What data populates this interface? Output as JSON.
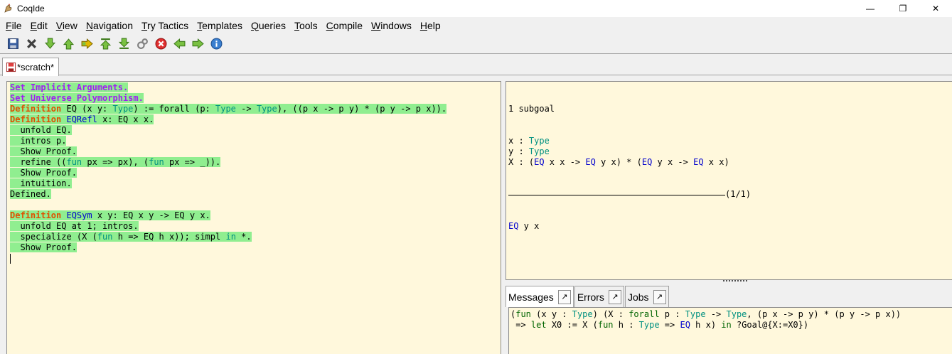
{
  "window": {
    "title": "CoqIde",
    "controls": {
      "minimize": "—",
      "restore": "❐",
      "close": "✕"
    }
  },
  "menu": [
    "File",
    "Edit",
    "View",
    "Navigation",
    "Try Tactics",
    "Templates",
    "Queries",
    "Tools",
    "Compile",
    "Windows",
    "Help"
  ],
  "toolbar_icons": [
    "save-icon",
    "close-icon",
    "step-forward-icon",
    "step-backward-icon",
    "goto-cursor-icon",
    "goto-start-icon",
    "goto-end-icon",
    "interrupt-icon",
    "stop-icon",
    "previous-occurrence-icon",
    "next-occurrence-icon",
    "info-icon"
  ],
  "tab": {
    "label": "*scratch*"
  },
  "script": {
    "lines": [
      [
        {
          "t": "Set Implicit Arguments.",
          "c": "kw"
        }
      ],
      [
        {
          "t": "Set Universe Polymorphism.",
          "c": "kw"
        }
      ],
      [
        {
          "t": "Definition",
          "c": "def"
        },
        {
          "t": " EQ (x y: "
        },
        {
          "t": "Type",
          "c": "ty"
        },
        {
          "t": ") := forall (p: "
        },
        {
          "t": "Type",
          "c": "ty"
        },
        {
          "t": " -> "
        },
        {
          "t": "Type",
          "c": "ty"
        },
        {
          "t": "), ((p x -> p y) * (p y -> p x))."
        }
      ],
      [
        {
          "t": "Definition",
          "c": "def"
        },
        {
          "t": " "
        },
        {
          "t": "EQRefl",
          "c": "id"
        },
        {
          "t": " x: EQ x x."
        }
      ],
      [
        {
          "t": "  unfold EQ."
        }
      ],
      [
        {
          "t": "  intros p."
        }
      ],
      [
        {
          "t": "  Show Proof."
        }
      ],
      [
        {
          "t": "  refine (("
        },
        {
          "t": "fun",
          "c": "ty"
        },
        {
          "t": " px => px), ("
        },
        {
          "t": "fun",
          "c": "ty"
        },
        {
          "t": " px => _))."
        }
      ],
      [
        {
          "t": "  Show Proof."
        }
      ],
      [
        {
          "t": "  intuition."
        }
      ],
      [
        {
          "t": "Defined."
        }
      ],
      [],
      [
        {
          "t": "Definition",
          "c": "def"
        },
        {
          "t": " "
        },
        {
          "t": "EQSym",
          "c": "id"
        },
        {
          "t": " x y: EQ x y -> EQ y x."
        }
      ],
      [
        {
          "t": "  unfold EQ at 1; intros."
        }
      ],
      [
        {
          "t": "  specialize (X ("
        },
        {
          "t": "fun",
          "c": "ty"
        },
        {
          "t": " h => EQ h x)); simpl "
        },
        {
          "t": "in",
          "c": "ty"
        },
        {
          "t": " *."
        }
      ],
      [
        {
          "t": "  Show Proof."
        }
      ]
    ]
  },
  "goals": {
    "count": "1 subgoal",
    "hyps": [
      [
        {
          "t": "x : "
        },
        {
          "t": "Type",
          "c": "ty"
        }
      ],
      [
        {
          "t": "y : "
        },
        {
          "t": "Type",
          "c": "ty"
        }
      ],
      [
        {
          "t": "X : ("
        },
        {
          "t": "EQ",
          "c": "id"
        },
        {
          "t": " x x -> "
        },
        {
          "t": "EQ",
          "c": "id"
        },
        {
          "t": " y x) * ("
        },
        {
          "t": "EQ",
          "c": "id"
        },
        {
          "t": " y x -> "
        },
        {
          "t": "EQ",
          "c": "id"
        },
        {
          "t": " x x)"
        }
      ]
    ],
    "index": "(1/1)",
    "goal": [
      {
        "t": "EQ",
        "c": "id"
      },
      {
        "t": " y x"
      }
    ]
  },
  "bottom_tabs": [
    {
      "label": "Messages",
      "detach": "↗"
    },
    {
      "label": "Errors",
      "detach": "↗"
    },
    {
      "label": "Jobs",
      "detach": "↗"
    }
  ],
  "messages": [
    [
      {
        "t": "("
      },
      {
        "t": "fun",
        "c": "mkw"
      },
      {
        "t": " (x y : "
      },
      {
        "t": "Type",
        "c": "mty"
      },
      {
        "t": ") (X : "
      },
      {
        "t": "forall",
        "c": "mkw"
      },
      {
        "t": " p : "
      },
      {
        "t": "Type",
        "c": "mty"
      },
      {
        "t": " -> "
      },
      {
        "t": "Type",
        "c": "mty"
      },
      {
        "t": ", (p x -> p y) * (p y -> p x))"
      }
    ],
    [
      {
        "t": " => "
      },
      {
        "t": "let",
        "c": "mkw"
      },
      {
        "t": " X0 := X ("
      },
      {
        "t": "fun",
        "c": "mkw"
      },
      {
        "t": " h : "
      },
      {
        "t": "Type",
        "c": "mty"
      },
      {
        "t": " => "
      },
      {
        "t": "EQ",
        "c": "mid"
      },
      {
        "t": " h x) "
      },
      {
        "t": "in",
        "c": "mkw"
      },
      {
        "t": " ?Goal@{X:=X0})"
      }
    ]
  ]
}
